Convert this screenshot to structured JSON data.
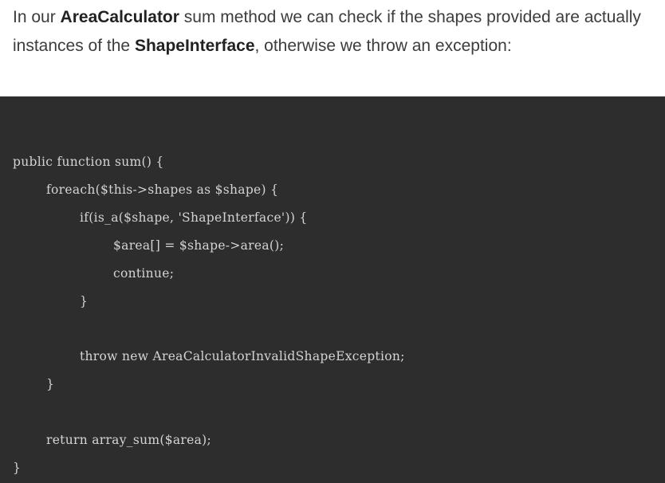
{
  "intro": {
    "t1": "In our ",
    "b1": "AreaCalculator",
    "t2": " sum method we can check if the shapes provided are actually",
    "t3": "instances of the ",
    "b2": "ShapeInterface",
    "t4": ", otherwise we throw an exception:"
  },
  "code": {
    "lines": [
      "public function sum() {",
      "foreach($this->shapes as $shape) {",
      "if(is_a($shape, 'ShapeInterface')) {",
      "$area[] = $shape->area();",
      "continue;",
      "}",
      "throw new AreaCalculatorInvalidShapeException;",
      "}",
      "return array_sum($area);",
      "}"
    ]
  },
  "colors": {
    "code_background": "#2d2d2d",
    "code_text": "#d4d4d4",
    "prose_text": "#3c3c3c"
  }
}
